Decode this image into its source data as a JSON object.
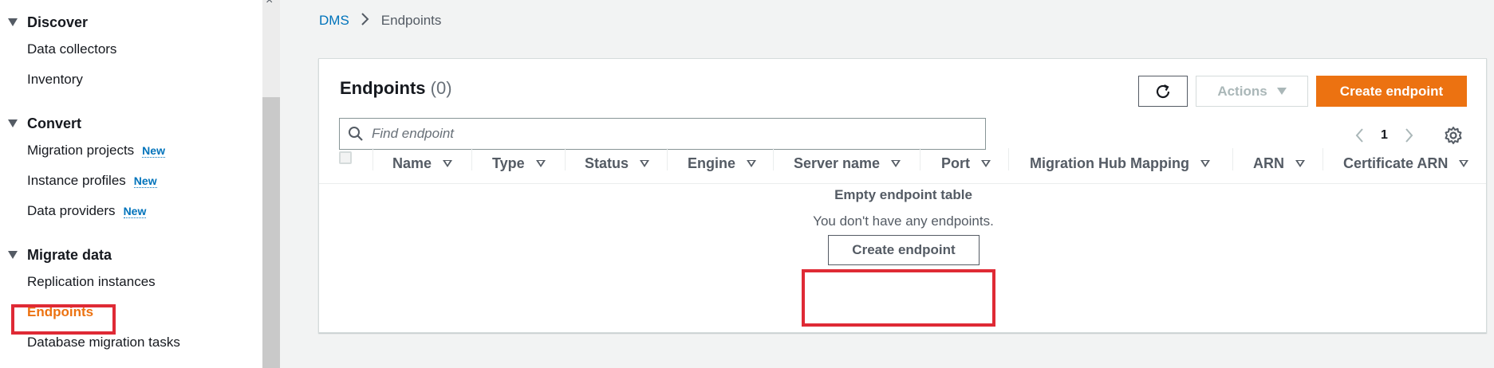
{
  "sidebar": {
    "sections": [
      {
        "title": "Discover",
        "items": [
          {
            "label": "Data collectors",
            "badge": ""
          },
          {
            "label": "Inventory",
            "badge": ""
          }
        ]
      },
      {
        "title": "Convert",
        "items": [
          {
            "label": "Migration projects",
            "badge": "New"
          },
          {
            "label": "Instance profiles",
            "badge": "New"
          },
          {
            "label": "Data providers",
            "badge": "New"
          }
        ]
      },
      {
        "title": "Migrate data",
        "items": [
          {
            "label": "Replication instances",
            "badge": ""
          },
          {
            "label": "Endpoints",
            "badge": "",
            "active": true
          },
          {
            "label": "Database migration tasks",
            "badge": ""
          }
        ]
      }
    ],
    "close_glyph": "×"
  },
  "breadcrumb": {
    "root": "DMS",
    "separator": "›",
    "current": "Endpoints"
  },
  "panel": {
    "title": "Endpoints",
    "count": "(0)",
    "actions_label": "Actions",
    "create_label": "Create endpoint",
    "search_placeholder": "Find endpoint",
    "page_number": "1",
    "columns": [
      "Name",
      "Type",
      "Status",
      "Engine",
      "Server name",
      "Port",
      "Migration Hub Mapping",
      "ARN",
      "Certificate ARN"
    ],
    "empty_title": "Empty endpoint table",
    "empty_description": "You don't have any endpoints.",
    "empty_create_label": "Create endpoint"
  },
  "colors": {
    "accent": "#ec7211",
    "link": "#0073bb",
    "highlight": "#df2a35"
  },
  "icons": {
    "refresh": "refresh-icon",
    "search": "search-icon",
    "settings": "gear-icon",
    "prev": "chevron-left-icon",
    "next": "chevron-right-icon"
  }
}
